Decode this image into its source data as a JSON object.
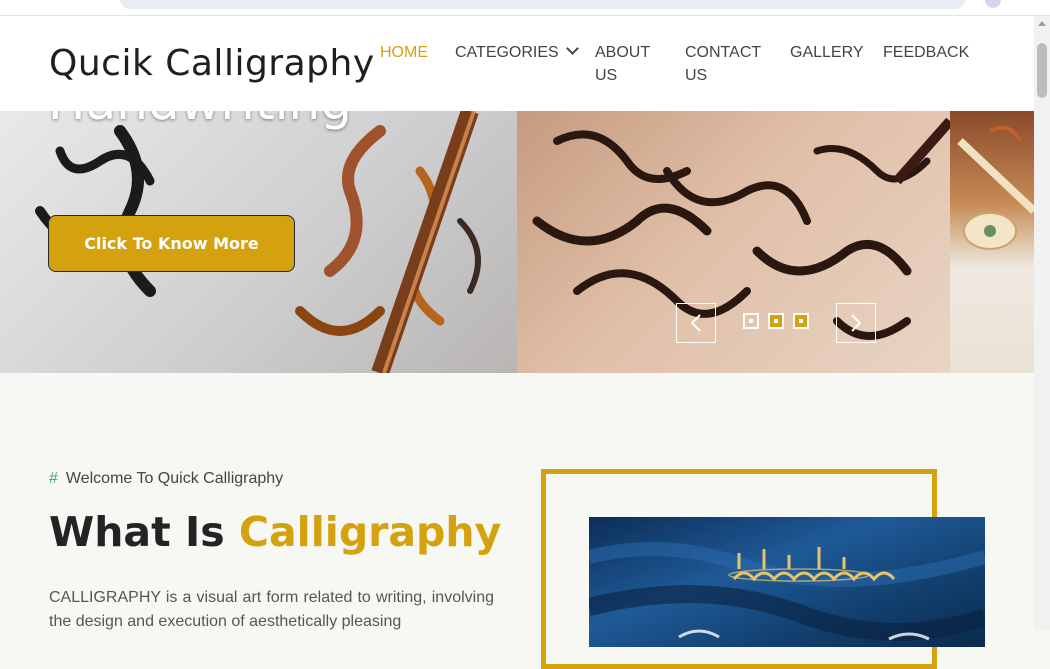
{
  "header": {
    "logo": "Qucik Calligraphy",
    "nav": [
      {
        "label": "HOME",
        "active": true
      },
      {
        "label": "CATEGORIES",
        "has_dropdown": true
      },
      {
        "label": "ABOUT US"
      },
      {
        "label": "CONTACT US"
      },
      {
        "label": "GALLERY"
      },
      {
        "label": "FEEDBACK"
      }
    ]
  },
  "hero": {
    "title": "Handwriting",
    "cta_label": "Click To Know More",
    "slides": 3,
    "active_slide": 1
  },
  "about": {
    "kicker_hash": "#",
    "kicker": "Welcome To Quick Calligraphy",
    "heading_plain": "What Is",
    "heading_accent": "Calligraphy",
    "paragraph": "CALLIGRAPHY is a visual art form related to writing, involving the design and execution of aesthetically pleasing"
  },
  "colors": {
    "accent": "#d4a10f",
    "hash": "#3fae5a",
    "text_dark": "#232323",
    "page_bg": "#f7f7f3"
  },
  "icons": [
    "chevron-down-icon",
    "arrow-left-icon",
    "arrow-right-icon"
  ]
}
